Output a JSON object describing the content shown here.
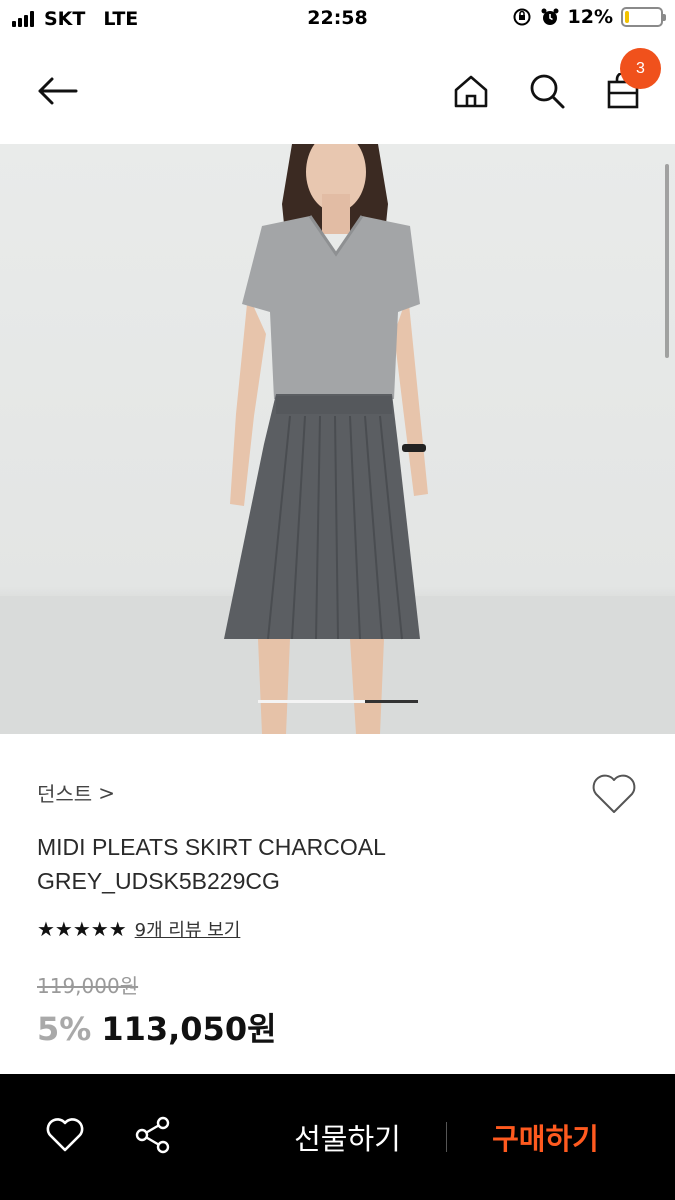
{
  "status_bar": {
    "carrier": "SKT",
    "network": "LTE",
    "time": "22:58",
    "battery_text": "12%",
    "battery_level": 0.12,
    "battery_color": "#f2c200"
  },
  "header": {
    "back_icon": "arrow-left-icon",
    "home_icon": "home-icon",
    "search_icon": "search-icon",
    "cart_icon": "shopping-bag-icon",
    "cart_count": "3",
    "badge_color": "#f0511c"
  },
  "gallery": {
    "progress_fraction": 0.33
  },
  "product": {
    "brand": "던스트",
    "brand_chevron": ">",
    "name_line1": "MIDI PLEATS SKIRT CHARCOAL",
    "name_line2": "GREY_UDSK5B229CG",
    "stars": "★★★★★",
    "rating": 5,
    "review_link": "9개 리뷰 보기",
    "original_price": "119,000원",
    "discount": "5%",
    "sale_price": "113,050원"
  },
  "bottom_bar": {
    "heart_icon": "heart-outline-icon",
    "share_icon": "share-icon",
    "gift_label": "선물하기",
    "buy_label": "구매하기",
    "buy_color": "#ff5a1f"
  }
}
